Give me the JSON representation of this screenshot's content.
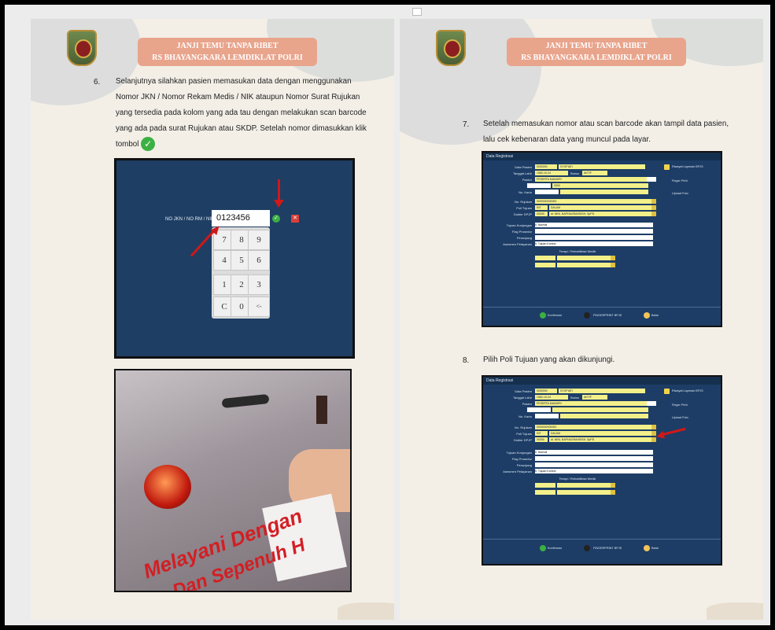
{
  "left_page": {
    "banner_line1": "JANJI TEMU TANPA RIBET",
    "banner_line2": "RS BHAYANGKARA LEMDIKLAT POLRI",
    "step_number": "6.",
    "step_lines": [
      "Selanjutnya silahkan pasien memasukan data dengan menggunakan",
      "Nomor JKN / Nomor Rekam Medis / NIK ataupun Nomor Surat Rujukan",
      "yang tersedia pada kolom yang ada tau dengan melakukan scan barcode",
      "yang ada pada surat Rujukan atau SKDP. Setelah nomor dimasukkan klik",
      "tombol"
    ],
    "keypad_screen": {
      "label": "NO JKN / NO RM / NIK",
      "input_value": "0123456",
      "keys": [
        "7",
        "8",
        "9",
        "4",
        "5",
        "6",
        "1",
        "2",
        "3",
        "C",
        "0",
        "<-"
      ]
    },
    "photo_text_line1": "Melayani Dengan",
    "photo_text_line2": "Dan Sepenuh H"
  },
  "right_page": {
    "banner_line1": "JANJI TEMU TANPA RIBET",
    "banner_line2": "RS BHAYANGKARA LEMDIKLAT POLRI",
    "step7_number": "7.",
    "step7_lines": [
      "Setelah memasukan nomor atau scan barcode akan tampil data pasien,",
      "lalu cek kebenaran data yang muncul pada layar."
    ],
    "step8_number": "8.",
    "step8_text": "Pilih Poli Tujuan yang akan dikunjungi.",
    "form": {
      "title": "Data Registrasi",
      "labels": [
        "Data Pasien",
        "Tanggal Lahir",
        "Pasien",
        "",
        "No. Kartu",
        "No. Rujukan",
        "Poli Tujuan",
        "Dokter DPJP",
        "Tujuan Kunjungan",
        "Flag Prosedur",
        "Penunjang",
        "Asesmen Pelayanan"
      ],
      "values": {
        "data_pasien": "0000000",
        "nama": "SYOPIATI",
        "tgl_lahir": "1982-10-24",
        "status_label": "Status",
        "status": "AKTIF",
        "pasien": "PESERTA MANDIRI",
        "no_rujukan": "0000000000000",
        "poli_code": "INT",
        "poli": "DALAM",
        "dokter_code": "00000",
        "dokter": "dr. NINI, NAPHAGRAHSISH, SpPD",
        "tujuan": "0. Normal",
        "asesmen": "5. Tujuan Kontrol",
        "terapi": "Terapi / Rehabilitasi Medik",
        "unit": "0000"
      },
      "side_buttons": [
        "Riwayat Layanan BPJS",
        "Finger Print",
        "Upload Foto"
      ],
      "footer": [
        "Konfirmasi",
        "FINGERPRINT BPJS",
        "Batal"
      ]
    }
  }
}
